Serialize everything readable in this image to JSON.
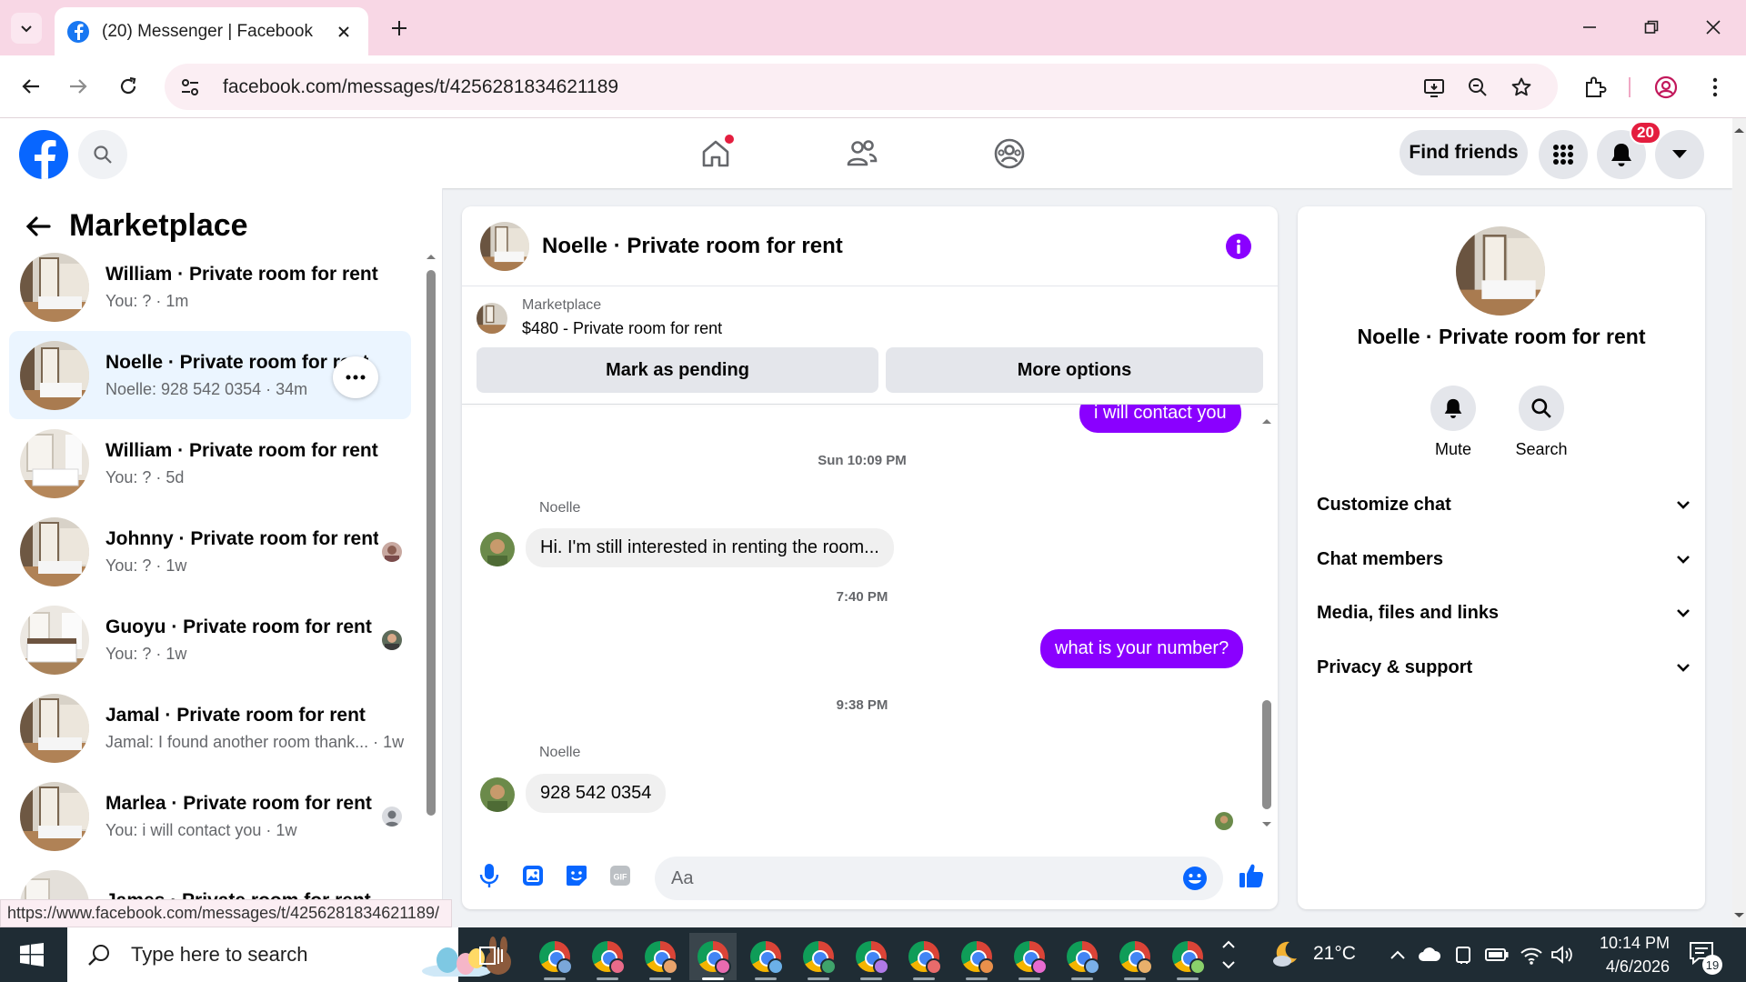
{
  "browser": {
    "tab_title": "(20) Messenger | Facebook",
    "url": "facebook.com/messages/t/4256281834621189",
    "status_url": "https://www.facebook.com/messages/t/4256281834621189/"
  },
  "fb_header": {
    "find_friends_label": "Find friends",
    "notification_count": "20"
  },
  "sidebar": {
    "title": "Marketplace",
    "conversations": [
      {
        "name": "William · Private room for rent",
        "preview": "You: ? · 1m",
        "active": false
      },
      {
        "name": "Noelle · Private room for rent",
        "preview": "Noelle: 928 542 0354 · 34m",
        "active": true
      },
      {
        "name": "William · Private room for rent",
        "preview": "You: ? · 5d",
        "active": false
      },
      {
        "name": "Johnny · Private room for rent",
        "preview": "You: ? · 1w",
        "active": false
      },
      {
        "name": "Guoyu · Private room for rent",
        "preview": "You: ? · 1w",
        "active": false
      },
      {
        "name": "Jamal · Private room for rent",
        "preview": "Jamal: I found another room thank... · 1w",
        "active": false
      },
      {
        "name": "Marlea · Private room for rent",
        "preview": "You: i will contact you · 1w",
        "active": false
      },
      {
        "name": "James · Private room for rent",
        "preview": "",
        "active": false
      }
    ]
  },
  "chat": {
    "title": "Noelle · Private room for rent",
    "listing_label": "Marketplace",
    "listing_price": "$480 - Private room for rent",
    "mark_pending_label": "Mark as pending",
    "more_options_label": "More options",
    "composer_placeholder": "Aa",
    "messages": {
      "out_partial": "i will contact you",
      "ts1": "Sun 10:09 PM",
      "sender1": "Noelle",
      "in1": "Hi.  I'm still interested in renting the room...",
      "ts2": "7:40 PM",
      "out2": "what is your number?",
      "ts3": "9:38 PM",
      "sender2": "Noelle",
      "in2": "928 542 0354"
    }
  },
  "info_panel": {
    "name": "Noelle · Private room for rent",
    "mute_label": "Mute",
    "search_label": "Search",
    "sections": [
      "Customize chat",
      "Chat members",
      "Media, files and links",
      "Privacy & support"
    ]
  },
  "taskbar": {
    "search_placeholder": "Type here to search",
    "temperature": "21°C",
    "time": "10:14 PM",
    "date": "4/6/2026",
    "notification_count": "19"
  },
  "colors": {
    "fb_blue": "#0866ff",
    "messenger_purple": "#8a00ff",
    "badge_red": "#e41e3f",
    "chrome_tab_strip": "#f8d7e5"
  }
}
